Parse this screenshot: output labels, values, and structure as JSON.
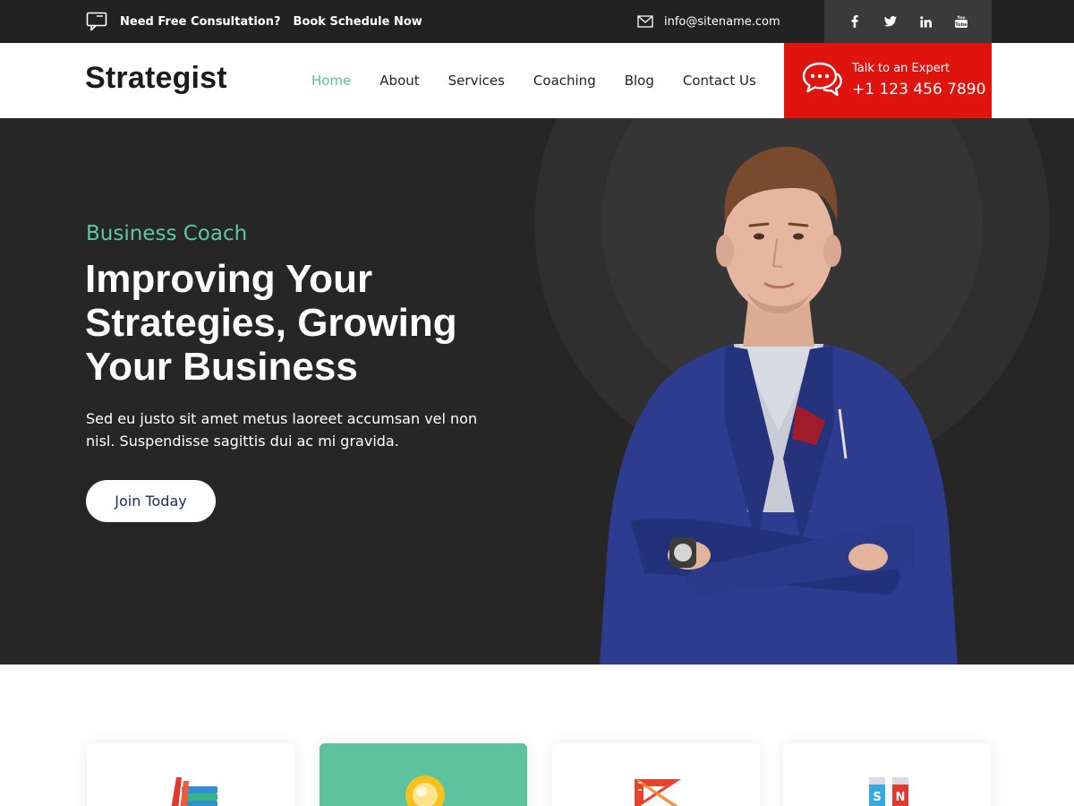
{
  "topbar": {
    "consult_label": "Need Free Consultation?",
    "schedule_link": "Book Schedule Now",
    "email": "info@sitename.com",
    "social": [
      {
        "icon": "facebook-icon",
        "glyph": "f"
      },
      {
        "icon": "twitter-icon",
        "glyph": "t"
      },
      {
        "icon": "linkedin-icon",
        "glyph": "in"
      },
      {
        "icon": "youtube-icon",
        "glyph": "You"
      }
    ]
  },
  "header": {
    "logo": "Strategist",
    "nav": [
      "Home",
      "About",
      "Services",
      "Coaching",
      "Blog",
      "Contact Us"
    ],
    "active_nav": "Home",
    "cta": {
      "label": "Talk to an Expert",
      "phone": "+1 123 456 7890"
    }
  },
  "hero": {
    "eyebrow": "Business Coach",
    "headline": "Improving Your Strategies, Growing Your Business",
    "description": "Sed eu justo sit amet metus laoreet accumsan vel non nisl. Suspendisse sagittis dui ac mi gravida.",
    "button": "Join Today"
  },
  "cards": [
    {
      "icon": "books-icon",
      "active": false
    },
    {
      "icon": "lightbulb-icon",
      "active": true
    },
    {
      "icon": "ruler-triangle-icon",
      "active": false
    },
    {
      "icon": "magnet-icon",
      "active": false
    }
  ],
  "colors": {
    "accent_green": "#5cc7a0",
    "cta_red": "#e0140f",
    "topbar_bg": "#222222",
    "hero_bg": "#262626",
    "suit_blue": "#2b3a8c"
  }
}
